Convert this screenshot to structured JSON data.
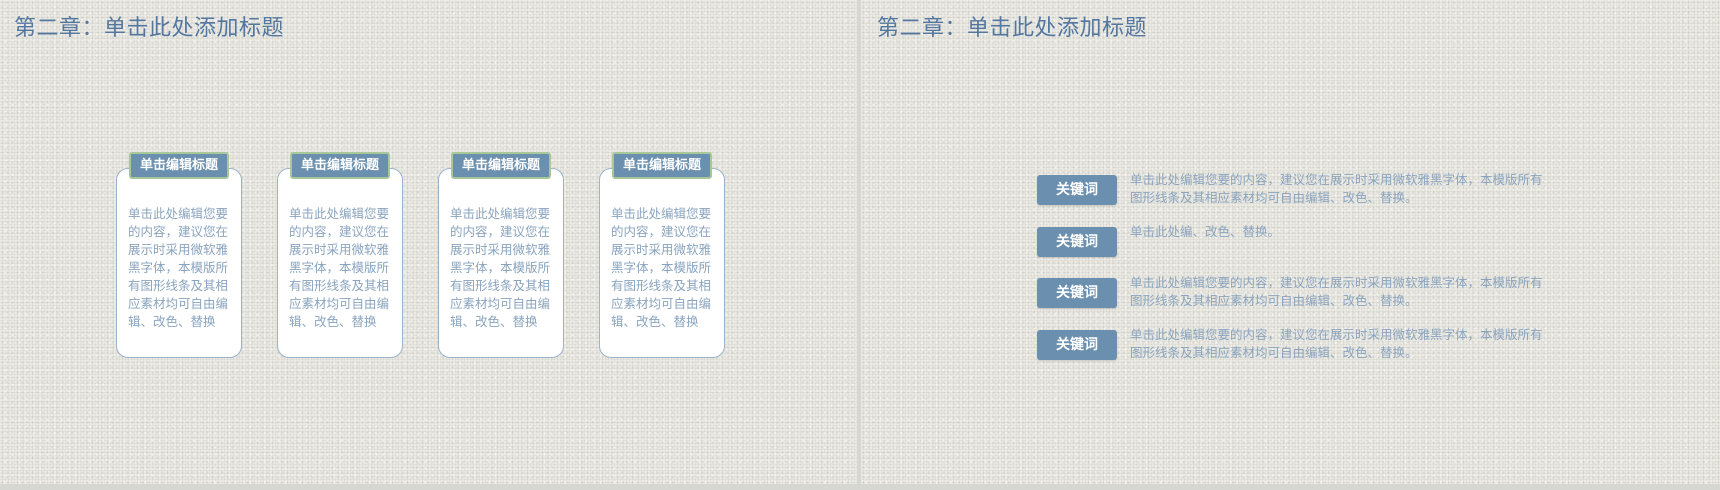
{
  "slides": {
    "left": {
      "title": "第二章：单击此处添加标题",
      "cards": [
        {
          "header": "单击编辑标题",
          "body": "单击此处编辑您要的内容，建议您在展示时采用微软雅黑字体，本模版所有图形线条及其相应素材均可自由编辑、改色、替换"
        },
        {
          "header": "单击编辑标题",
          "body": "单击此处编辑您要的内容，建议您在展示时采用微软雅黑字体，本模版所有图形线条及其相应素材均可自由编辑、改色、替换"
        },
        {
          "header": "单击编辑标题",
          "body": "单击此处编辑您要的内容，建议您在展示时采用微软雅黑字体，本模版所有图形线条及其相应素材均可自由编辑、改色、替换"
        },
        {
          "header": "单击编辑标题",
          "body": "单击此处编辑您要的内容，建议您在展示时采用微软雅黑字体，本模版所有图形线条及其相应素材均可自由编辑、改色、替换"
        }
      ]
    },
    "right": {
      "title": "第二章：单击此处添加标题",
      "keywords": [
        {
          "label": "关键词",
          "text": "单击此处编辑您要的内容，建议您在展示时采用微软雅黑字体，本模版所有图形线条及其相应素材均可自由编辑、改色、替换。"
        },
        {
          "label": "关键词",
          "text": "单击此处编、改色、替换。"
        },
        {
          "label": "关键词",
          "text": "单击此处编辑您要的内容，建议您在展示时采用微软雅黑字体，本模版所有图形线条及其相应素材均可自由编辑、改色、替换。"
        },
        {
          "label": "关键词",
          "text": "单击此处编辑您要的内容，建议您在展示时采用微软雅黑字体，本模版所有图形线条及其相应素材均可自由编辑、改色、替换。"
        }
      ]
    }
  },
  "colors": {
    "accent": "#6b8fae",
    "title": "#5477a0",
    "body_text": "#8aa4bf",
    "header_border": "#a8c89a"
  }
}
